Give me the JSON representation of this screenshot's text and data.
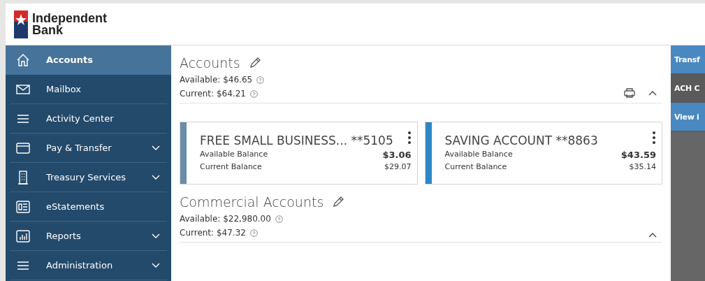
{
  "brand": {
    "line_1": "Independent",
    "line_2": "Bank"
  },
  "sidebar": {
    "items": [
      {
        "label": "Accounts",
        "selected": true,
        "expandable": false
      },
      {
        "label": "Mailbox",
        "selected": false,
        "expandable": false
      },
      {
        "label": "Activity Center",
        "selected": false,
        "expandable": false
      },
      {
        "label": "Pay & Transfer",
        "selected": false,
        "expandable": true
      },
      {
        "label": "Treasury Services",
        "selected": false,
        "expandable": true
      },
      {
        "label": "eStatements",
        "selected": false,
        "expandable": false
      },
      {
        "label": "Reports",
        "selected": false,
        "expandable": true
      },
      {
        "label": "Administration",
        "selected": false,
        "expandable": true
      }
    ]
  },
  "sections": [
    {
      "title": "Accounts",
      "available": "Available: $46.65",
      "current": "Current: $64.21",
      "printable": true,
      "expanded": true,
      "cards": [
        {
          "name": "FREE SMALL BUSINESS... **5105",
          "color": "#6a8ca8",
          "available_label": "Available Balance",
          "available": "$3.06",
          "current_label": "Current Balance",
          "current": "$29.07"
        },
        {
          "name": "SAVING ACCOUNT **8863",
          "color": "#2e86c8",
          "available_label": "Available Balance",
          "available": "$43.59",
          "current_label": "Current Balance",
          "current": "$35.14"
        }
      ]
    },
    {
      "title": "Commercial Accounts",
      "available": "Available: $22,980.00",
      "current": "Current: $47.32",
      "printable": false,
      "expanded": true
    }
  ],
  "quick_actions": [
    {
      "label": "Transf",
      "kind": "primary"
    },
    {
      "label": "ACH C",
      "kind": "secondary"
    },
    {
      "label": "View i",
      "kind": "primary"
    }
  ]
}
